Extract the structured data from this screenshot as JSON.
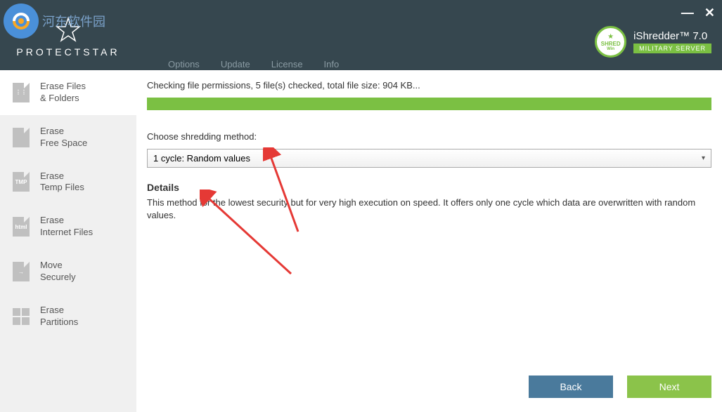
{
  "brand": "PROTECTSTAR",
  "watermark_text": "河东软件园",
  "window_controls": {
    "minimize": "—",
    "close": "✕"
  },
  "menu": {
    "options": "Options",
    "update": "Update",
    "license": "License",
    "info": "Info"
  },
  "product": {
    "badge_line1": "★",
    "badge_line2": "SHRED",
    "badge_line3": "Win",
    "name": "iShredder™ 7.0",
    "edition": "MILITARY SERVER"
  },
  "sidebar": {
    "items": [
      {
        "label": "Erase Files\n& Folders",
        "icon": "⋮⋮"
      },
      {
        "label": "Erase\nFree Space",
        "icon": ""
      },
      {
        "label": "Erase\nTemp Files",
        "icon": "TMP"
      },
      {
        "label": "Erase\nInternet Files",
        "icon": "html"
      },
      {
        "label": "Move\nSecurely",
        "icon": "→"
      },
      {
        "label": "Erase\nPartitions",
        "icon": ""
      }
    ]
  },
  "content": {
    "status": "Checking file permissions, 5 file(s) checked, total file size: 904 KB...",
    "method_label": "Choose shredding method:",
    "method_value": "1 cycle: Random values",
    "details_heading": "Details",
    "details_text": "This method for the lowest security but for very high execution on speed. It offers only one cycle which data are overwritten with random values."
  },
  "buttons": {
    "back": "Back",
    "next": "Next"
  }
}
